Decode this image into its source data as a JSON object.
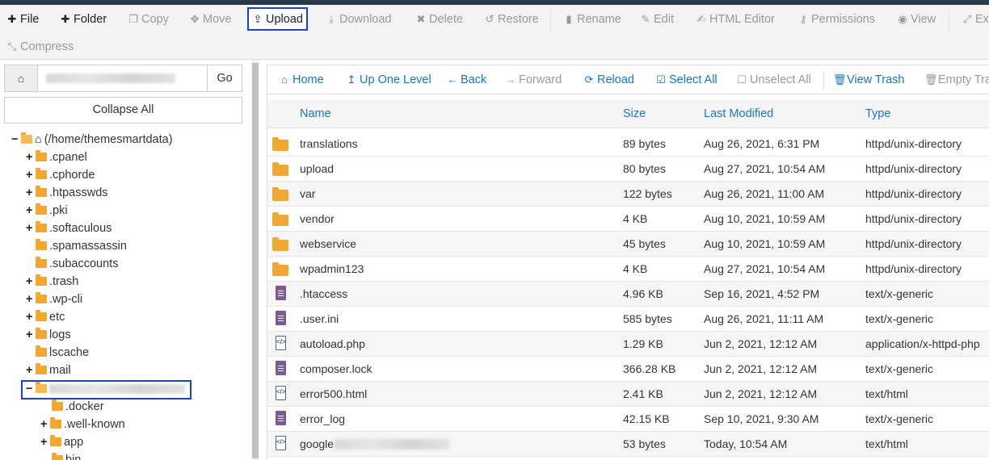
{
  "toolbar": {
    "file": "File",
    "folder": "Folder",
    "copy": "Copy",
    "move": "Move",
    "upload": "Upload",
    "download": "Download",
    "delete": "Delete",
    "restore": "Restore",
    "rename": "Rename",
    "edit": "Edit",
    "html_editor": "HTML Editor",
    "permissions": "Permissions",
    "view": "View",
    "extract": "Ex",
    "compress": "Compress"
  },
  "left": {
    "go": "Go",
    "collapse_all": "Collapse All",
    "root": "(/home/themesmartdata)",
    "items": [
      {
        "label": ".cpanel"
      },
      {
        "label": ".cphorde"
      },
      {
        "label": ".htpasswds"
      },
      {
        "label": ".pki"
      },
      {
        "label": ".softaculous"
      },
      {
        "label": ".spamassassin"
      },
      {
        "label": ".subaccounts"
      },
      {
        "label": ".trash"
      },
      {
        "label": ".wp-cli"
      },
      {
        "label": "etc"
      },
      {
        "label": "logs"
      },
      {
        "label": "lscache"
      },
      {
        "label": "mail"
      }
    ],
    "sub_items": [
      {
        "label": ".docker"
      },
      {
        "label": ".well-known"
      },
      {
        "label": "app"
      },
      {
        "label": "bin"
      }
    ]
  },
  "nav": {
    "home": "Home",
    "up_one_level": "Up One Level",
    "back": "Back",
    "forward": "Forward",
    "reload": "Reload",
    "select_all": "Select All",
    "unselect_all": "Unselect All",
    "view_trash": "View Trash",
    "empty_trash": "Empty Tra"
  },
  "table": {
    "headers": {
      "name": "Name",
      "size": "Size",
      "modified": "Last Modified",
      "type": "Type"
    },
    "rows": [
      {
        "name": "translations",
        "size": "89 bytes",
        "modified": "Aug 26, 2021, 6:31 PM",
        "type": "httpd/unix-directory",
        "icon": "folder-icon"
      },
      {
        "name": "upload",
        "size": "80 bytes",
        "modified": "Aug 27, 2021, 10:54 AM",
        "type": "httpd/unix-directory",
        "icon": "folder-icon"
      },
      {
        "name": "var",
        "size": "122 bytes",
        "modified": "Aug 26, 2021, 11:00 AM",
        "type": "httpd/unix-directory",
        "icon": "folder-icon"
      },
      {
        "name": "vendor",
        "size": "4 KB",
        "modified": "Aug 10, 2021, 10:59 AM",
        "type": "httpd/unix-directory",
        "icon": "folder-icon"
      },
      {
        "name": "webservice",
        "size": "45 bytes",
        "modified": "Aug 10, 2021, 10:59 AM",
        "type": "httpd/unix-directory",
        "icon": "folder-icon"
      },
      {
        "name": "wpadmin123",
        "size": "4 KB",
        "modified": "Aug 27, 2021, 10:54 AM",
        "type": "httpd/unix-directory",
        "icon": "folder-icon"
      },
      {
        "name": ".htaccess",
        "size": "4.96 KB",
        "modified": "Sep 16, 2021, 4:52 PM",
        "type": "text/x-generic",
        "icon": "text-file-icon"
      },
      {
        "name": ".user.ini",
        "size": "585 bytes",
        "modified": "Aug 26, 2021, 11:11 AM",
        "type": "text/x-generic",
        "icon": "text-file-icon"
      },
      {
        "name": "autoload.php",
        "size": "1.29 KB",
        "modified": "Jun 2, 2021, 12:12 AM",
        "type": "application/x-httpd-php",
        "icon": "code-file-icon"
      },
      {
        "name": "composer.lock",
        "size": "366.28 KB",
        "modified": "Jun 2, 2021, 12:12 AM",
        "type": "text/x-generic",
        "icon": "text-file-icon"
      },
      {
        "name": "error500.html",
        "size": "2.41 KB",
        "modified": "Jun 2, 2021, 12:12 AM",
        "type": "text/html",
        "icon": "code-file-icon"
      },
      {
        "name": "error_log",
        "size": "42.15 KB",
        "modified": "Sep 10, 2021, 9:30 AM",
        "type": "text/x-generic",
        "icon": "text-file-icon"
      },
      {
        "name": "google",
        "size": "53 bytes",
        "modified": "Today, 10:54 AM",
        "type": "text/html",
        "icon": "code-file-icon"
      }
    ]
  },
  "colors": {
    "link": "#1976c4",
    "highlight": "#1a3fd8",
    "folder": "#f0a830",
    "textfile": "#7d5a94"
  }
}
